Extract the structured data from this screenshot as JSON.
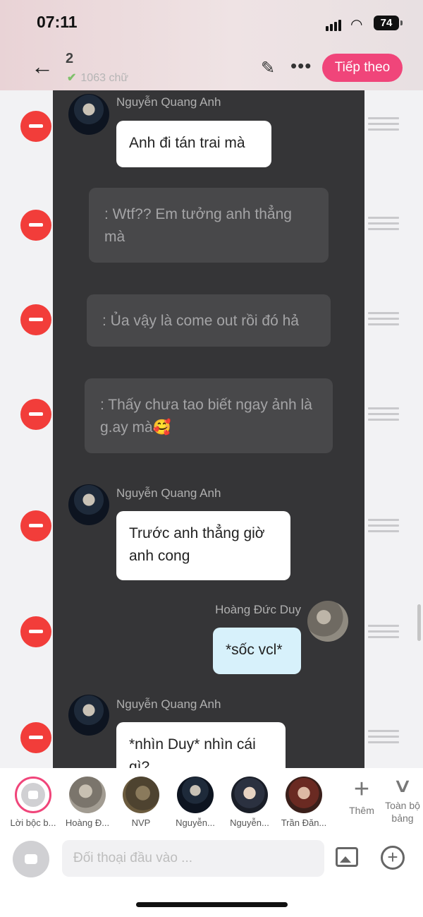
{
  "status": {
    "time": "07:11",
    "battery": "74"
  },
  "header": {
    "back_icon": "←",
    "title": "2",
    "word_count": "1063 chữ",
    "next_label": "Tiếp theo",
    "pencil_icon": "✎",
    "more_icon": "•••"
  },
  "messages": [
    {
      "type": "char",
      "name": "Nguyễn Quang Anh",
      "text": "Anh đi tán trai mà"
    },
    {
      "type": "narr",
      "text": ": Wtf?? Em tưởng anh thẳng mà"
    },
    {
      "type": "narr",
      "text": ": Ủa vậy là come out rồi đó hả"
    },
    {
      "type": "narr",
      "text": ": Thấy chưa tao biết ngay ảnh là g.ay mà🥰"
    },
    {
      "type": "char",
      "name": "Nguyễn Quang Anh",
      "text": "Trước anh thẳng giờ anh cong"
    },
    {
      "type": "char",
      "name": "Hoàng Đức Duy",
      "text": "*sốc vcl*"
    },
    {
      "type": "char",
      "name": "Nguyễn Quang Anh",
      "text": "*nhìn Duy* nhìn cái gì?"
    }
  ],
  "characters": [
    {
      "label": "Lời bộc b..."
    },
    {
      "label": "Hoàng Đ..."
    },
    {
      "label": "NVP"
    },
    {
      "label": "Nguyễn..."
    },
    {
      "label": "Nguyễn..."
    },
    {
      "label": "Trần Đăn..."
    }
  ],
  "actions": {
    "add_label": "Thêm",
    "all_label": "Toàn bộ bảng"
  },
  "input": {
    "placeholder": "Đối thoại đầu vào ..."
  },
  "colors": {
    "accent": "#f0457a",
    "panel": "#353537",
    "delete": "#f23d3a"
  }
}
